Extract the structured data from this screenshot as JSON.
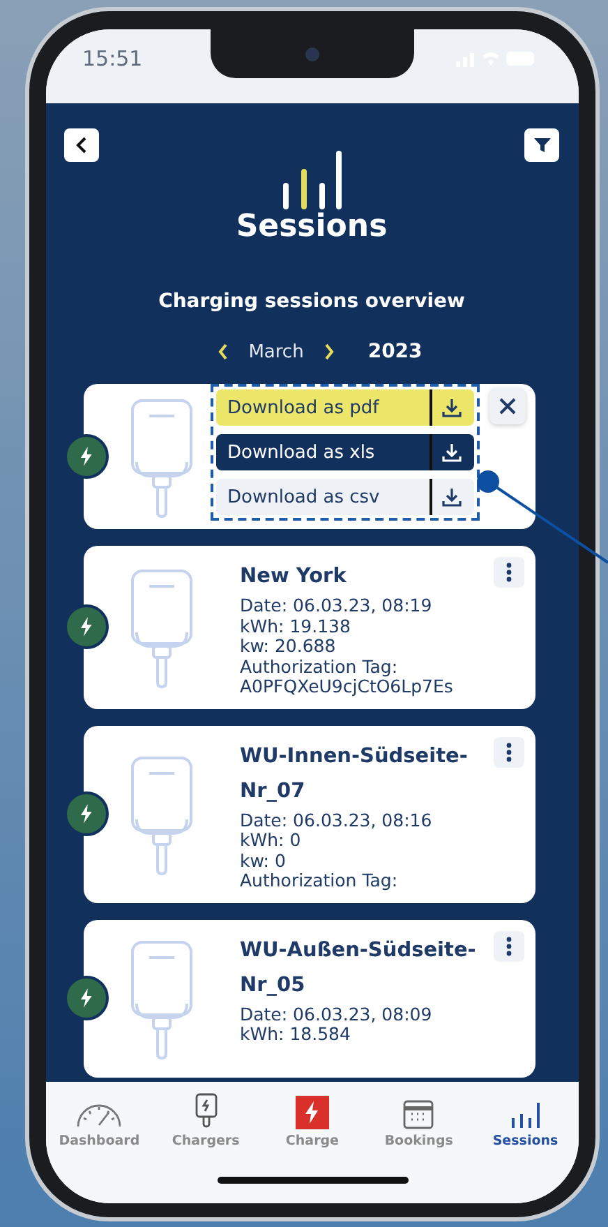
{
  "status_bar": {
    "time": "15:51"
  },
  "header": {
    "title": "Sessions",
    "subtitle": "Charging sessions overview"
  },
  "period": {
    "month": "March",
    "year": "2023"
  },
  "export_menu": {
    "items": [
      {
        "label": "Download as pdf",
        "color": "#ece66a"
      },
      {
        "label": "Download as xls",
        "color": "#12305c"
      },
      {
        "label": "Download as csv",
        "color": "#eef2f7"
      }
    ]
  },
  "sessions": [
    {
      "menu_open": true
    },
    {
      "menu_open": false,
      "name": "New York",
      "lines": [
        "Date: 06.03.23, 08:19",
        "kWh: 19.138",
        "kw: 20.688",
        "Authorization Tag:",
        "A0PFQXeU9cjCtO6Lp7Es"
      ]
    },
    {
      "menu_open": false,
      "name": "WU-Innen-Südseite-Nr_07",
      "lines": [
        "Date: 06.03.23, 08:16",
        "kWh: 0",
        "kw: 0",
        "Authorization Tag:"
      ]
    },
    {
      "menu_open": false,
      "name": "WU-Außen-Südseite-Nr_05",
      "lines": [
        "Date: 06.03.23, 08:09",
        "kWh: 18.584"
      ]
    }
  ],
  "tabs": [
    {
      "kind": "gauge",
      "label": "Dashboard",
      "selected": false
    },
    {
      "kind": "charger",
      "label": "Chargers",
      "selected": false
    },
    {
      "kind": "charge",
      "label": "Charge",
      "selected": false
    },
    {
      "kind": "calendar",
      "label": "Bookings",
      "selected": false
    },
    {
      "kind": "bars",
      "label": "Sessions",
      "selected": true
    }
  ]
}
